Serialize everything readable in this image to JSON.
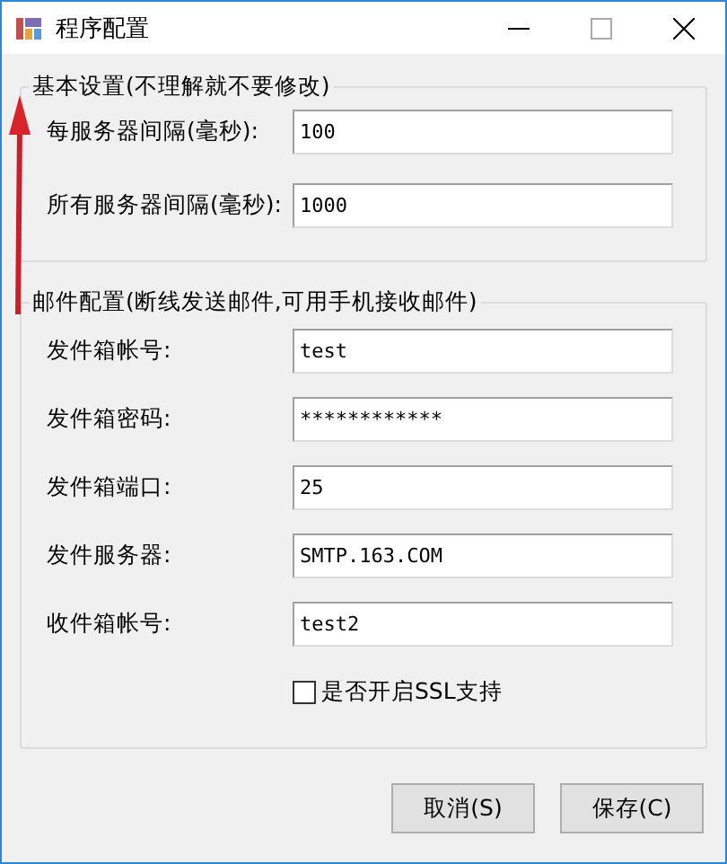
{
  "window": {
    "title": "程序配置"
  },
  "groups": [
    {
      "title": "基本设置(不理解就不要修改)",
      "fields": [
        {
          "label": "每服务器间隔(毫秒):",
          "value": "100"
        },
        {
          "label": "所有服务器间隔(毫秒):",
          "value": "1000"
        }
      ]
    },
    {
      "title": "邮件配置(断线发送邮件,可用手机接收邮件)",
      "fields": [
        {
          "label": "发件箱帐号:",
          "value": "test"
        },
        {
          "label": "发件箱密码:",
          "value": "************"
        },
        {
          "label": "发件箱端口:",
          "value": "25"
        },
        {
          "label": "发件服务器:",
          "value": "SMTP.163.COM"
        },
        {
          "label": "收件箱帐号:",
          "value": "test2"
        }
      ],
      "checkbox": {
        "label": "是否开启SSL支持",
        "checked": false
      }
    }
  ],
  "buttons": [
    "取消(S)",
    "保存(C)"
  ]
}
